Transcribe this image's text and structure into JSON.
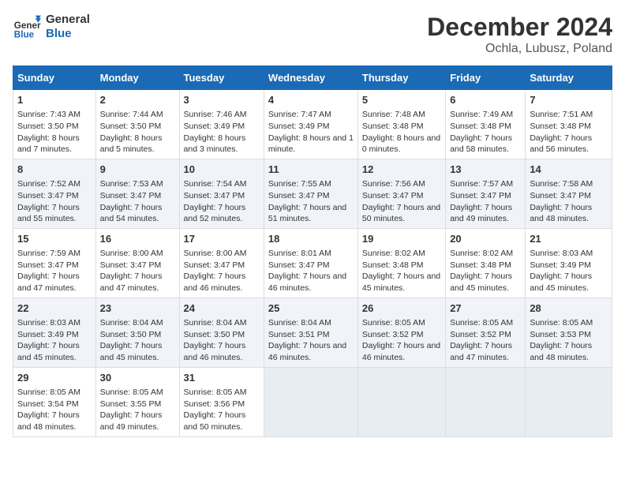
{
  "header": {
    "logo_line1": "General",
    "logo_line2": "Blue",
    "title": "December 2024",
    "subtitle": "Ochla, Lubusz, Poland"
  },
  "days_of_week": [
    "Sunday",
    "Monday",
    "Tuesday",
    "Wednesday",
    "Thursday",
    "Friday",
    "Saturday"
  ],
  "weeks": [
    [
      {
        "day": 1,
        "sunrise": "Sunrise: 7:43 AM",
        "sunset": "Sunset: 3:50 PM",
        "daylight": "Daylight: 8 hours and 7 minutes."
      },
      {
        "day": 2,
        "sunrise": "Sunrise: 7:44 AM",
        "sunset": "Sunset: 3:50 PM",
        "daylight": "Daylight: 8 hours and 5 minutes."
      },
      {
        "day": 3,
        "sunrise": "Sunrise: 7:46 AM",
        "sunset": "Sunset: 3:49 PM",
        "daylight": "Daylight: 8 hours and 3 minutes."
      },
      {
        "day": 4,
        "sunrise": "Sunrise: 7:47 AM",
        "sunset": "Sunset: 3:49 PM",
        "daylight": "Daylight: 8 hours and 1 minute."
      },
      {
        "day": 5,
        "sunrise": "Sunrise: 7:48 AM",
        "sunset": "Sunset: 3:48 PM",
        "daylight": "Daylight: 8 hours and 0 minutes."
      },
      {
        "day": 6,
        "sunrise": "Sunrise: 7:49 AM",
        "sunset": "Sunset: 3:48 PM",
        "daylight": "Daylight: 7 hours and 58 minutes."
      },
      {
        "day": 7,
        "sunrise": "Sunrise: 7:51 AM",
        "sunset": "Sunset: 3:48 PM",
        "daylight": "Daylight: 7 hours and 56 minutes."
      }
    ],
    [
      {
        "day": 8,
        "sunrise": "Sunrise: 7:52 AM",
        "sunset": "Sunset: 3:47 PM",
        "daylight": "Daylight: 7 hours and 55 minutes."
      },
      {
        "day": 9,
        "sunrise": "Sunrise: 7:53 AM",
        "sunset": "Sunset: 3:47 PM",
        "daylight": "Daylight: 7 hours and 54 minutes."
      },
      {
        "day": 10,
        "sunrise": "Sunrise: 7:54 AM",
        "sunset": "Sunset: 3:47 PM",
        "daylight": "Daylight: 7 hours and 52 minutes."
      },
      {
        "day": 11,
        "sunrise": "Sunrise: 7:55 AM",
        "sunset": "Sunset: 3:47 PM",
        "daylight": "Daylight: 7 hours and 51 minutes."
      },
      {
        "day": 12,
        "sunrise": "Sunrise: 7:56 AM",
        "sunset": "Sunset: 3:47 PM",
        "daylight": "Daylight: 7 hours and 50 minutes."
      },
      {
        "day": 13,
        "sunrise": "Sunrise: 7:57 AM",
        "sunset": "Sunset: 3:47 PM",
        "daylight": "Daylight: 7 hours and 49 minutes."
      },
      {
        "day": 14,
        "sunrise": "Sunrise: 7:58 AM",
        "sunset": "Sunset: 3:47 PM",
        "daylight": "Daylight: 7 hours and 48 minutes."
      }
    ],
    [
      {
        "day": 15,
        "sunrise": "Sunrise: 7:59 AM",
        "sunset": "Sunset: 3:47 PM",
        "daylight": "Daylight: 7 hours and 47 minutes."
      },
      {
        "day": 16,
        "sunrise": "Sunrise: 8:00 AM",
        "sunset": "Sunset: 3:47 PM",
        "daylight": "Daylight: 7 hours and 47 minutes."
      },
      {
        "day": 17,
        "sunrise": "Sunrise: 8:00 AM",
        "sunset": "Sunset: 3:47 PM",
        "daylight": "Daylight: 7 hours and 46 minutes."
      },
      {
        "day": 18,
        "sunrise": "Sunrise: 8:01 AM",
        "sunset": "Sunset: 3:47 PM",
        "daylight": "Daylight: 7 hours and 46 minutes."
      },
      {
        "day": 19,
        "sunrise": "Sunrise: 8:02 AM",
        "sunset": "Sunset: 3:48 PM",
        "daylight": "Daylight: 7 hours and 45 minutes."
      },
      {
        "day": 20,
        "sunrise": "Sunrise: 8:02 AM",
        "sunset": "Sunset: 3:48 PM",
        "daylight": "Daylight: 7 hours and 45 minutes."
      },
      {
        "day": 21,
        "sunrise": "Sunrise: 8:03 AM",
        "sunset": "Sunset: 3:49 PM",
        "daylight": "Daylight: 7 hours and 45 minutes."
      }
    ],
    [
      {
        "day": 22,
        "sunrise": "Sunrise: 8:03 AM",
        "sunset": "Sunset: 3:49 PM",
        "daylight": "Daylight: 7 hours and 45 minutes."
      },
      {
        "day": 23,
        "sunrise": "Sunrise: 8:04 AM",
        "sunset": "Sunset: 3:50 PM",
        "daylight": "Daylight: 7 hours and 45 minutes."
      },
      {
        "day": 24,
        "sunrise": "Sunrise: 8:04 AM",
        "sunset": "Sunset: 3:50 PM",
        "daylight": "Daylight: 7 hours and 46 minutes."
      },
      {
        "day": 25,
        "sunrise": "Sunrise: 8:04 AM",
        "sunset": "Sunset: 3:51 PM",
        "daylight": "Daylight: 7 hours and 46 minutes."
      },
      {
        "day": 26,
        "sunrise": "Sunrise: 8:05 AM",
        "sunset": "Sunset: 3:52 PM",
        "daylight": "Daylight: 7 hours and 46 minutes."
      },
      {
        "day": 27,
        "sunrise": "Sunrise: 8:05 AM",
        "sunset": "Sunset: 3:52 PM",
        "daylight": "Daylight: 7 hours and 47 minutes."
      },
      {
        "day": 28,
        "sunrise": "Sunrise: 8:05 AM",
        "sunset": "Sunset: 3:53 PM",
        "daylight": "Daylight: 7 hours and 48 minutes."
      }
    ],
    [
      {
        "day": 29,
        "sunrise": "Sunrise: 8:05 AM",
        "sunset": "Sunset: 3:54 PM",
        "daylight": "Daylight: 7 hours and 48 minutes."
      },
      {
        "day": 30,
        "sunrise": "Sunrise: 8:05 AM",
        "sunset": "Sunset: 3:55 PM",
        "daylight": "Daylight: 7 hours and 49 minutes."
      },
      {
        "day": 31,
        "sunrise": "Sunrise: 8:05 AM",
        "sunset": "Sunset: 3:56 PM",
        "daylight": "Daylight: 7 hours and 50 minutes."
      },
      null,
      null,
      null,
      null
    ]
  ]
}
